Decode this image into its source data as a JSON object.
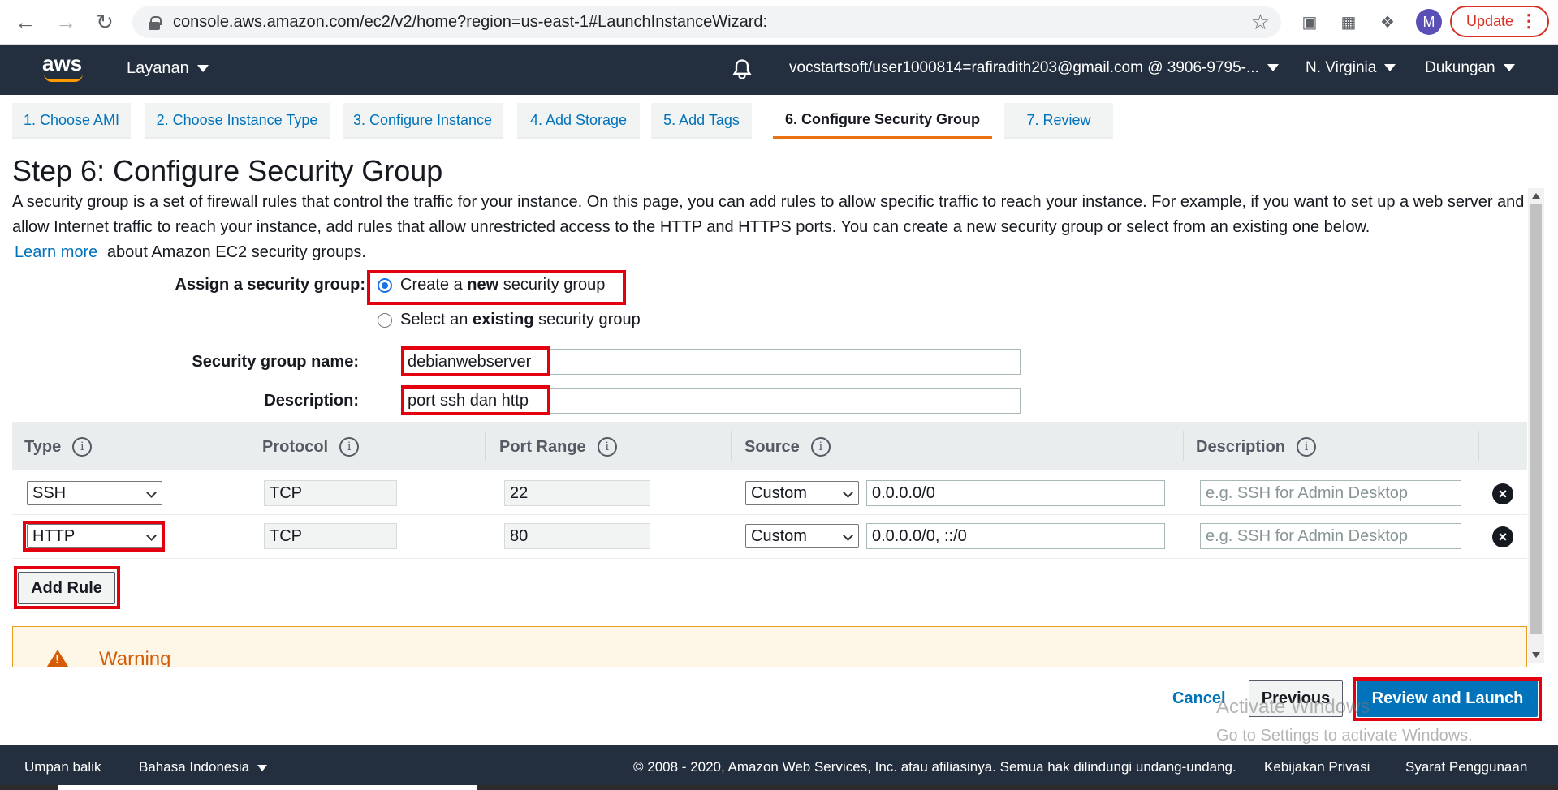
{
  "browser": {
    "url": "console.aws.amazon.com/ec2/v2/home?region=us-east-1#LaunchInstanceWizard:",
    "avatar_letter": "M",
    "update_label": "Update"
  },
  "topnav": {
    "logo_text": "aws",
    "services_label": "Layanan",
    "account_label": "vocstartsoft/user1000814=rafiradith203@gmail.com @ 3906-9795-...",
    "region_label": "N. Virginia",
    "support_label": "Dukungan"
  },
  "steps": [
    {
      "label": "1. Choose AMI",
      "active": false
    },
    {
      "label": "2. Choose Instance Type",
      "active": false
    },
    {
      "label": "3. Configure Instance",
      "active": false
    },
    {
      "label": "4. Add Storage",
      "active": false
    },
    {
      "label": "5. Add Tags",
      "active": false
    },
    {
      "label": "6. Configure Security Group",
      "active": true
    },
    {
      "label": "7. Review",
      "active": false
    }
  ],
  "page": {
    "title": "Step 6: Configure Security Group",
    "intro": "A security group is a set of firewall rules that control the traffic for your instance. On this page, you can add rules to allow specific traffic to reach your instance. For example, if you want to set up a web server and allow Internet traffic to reach your instance, add rules that allow unrestricted access to the HTTP and HTTPS ports. You can create a new security group or select from an existing one below.",
    "learn_more": "Learn more",
    "learn_more_suffix": "about Amazon EC2 security groups."
  },
  "form": {
    "assign_label": "Assign a security group:",
    "option_new_prefix": "Create a ",
    "option_new_bold": "new",
    "option_new_suffix": " security group",
    "option_existing_prefix": "Select an ",
    "option_existing_bold": "existing",
    "option_existing_suffix": " security group",
    "name_label": "Security group name:",
    "name_value": "debianwebserver",
    "desc_label": "Description:",
    "desc_value": "port ssh dan http"
  },
  "table": {
    "headers": {
      "type": "Type",
      "protocol": "Protocol",
      "port_range": "Port Range",
      "source": "Source",
      "description": "Description"
    },
    "info_icon_glyph": "i",
    "rows": [
      {
        "type": "SSH",
        "protocol": "TCP",
        "port": "22",
        "source_type": "Custom",
        "source": "0.0.0.0/0",
        "desc_placeholder": "e.g. SSH for Admin Desktop"
      },
      {
        "type": "HTTP",
        "protocol": "TCP",
        "port": "80",
        "source_type": "Custom",
        "source": "0.0.0.0/0, ::/0",
        "desc_placeholder": "e.g. SSH for Admin Desktop"
      }
    ],
    "add_rule_label": "Add Rule"
  },
  "warning": {
    "title": "Warning"
  },
  "actions": {
    "cancel": "Cancel",
    "previous": "Previous",
    "review_launch": "Review and Launch"
  },
  "watermark": {
    "line1": "Activate Windows",
    "line2": "Go to Settings to activate Windows."
  },
  "footer": {
    "feedback": "Umpan balik",
    "language": "Bahasa Indonesia",
    "copyright": "© 2008 - 2020, Amazon Web Services, Inc. atau afiliasinya. Semua hak dilindungi undang-undang.",
    "privacy": "Kebijakan Privasi",
    "terms": "Syarat Penggunaan"
  },
  "colors": {
    "aws_nav": "#232f3e",
    "accent_orange": "#ec7211",
    "link_blue": "#0073bb",
    "highlight_red": "#e3000f"
  }
}
